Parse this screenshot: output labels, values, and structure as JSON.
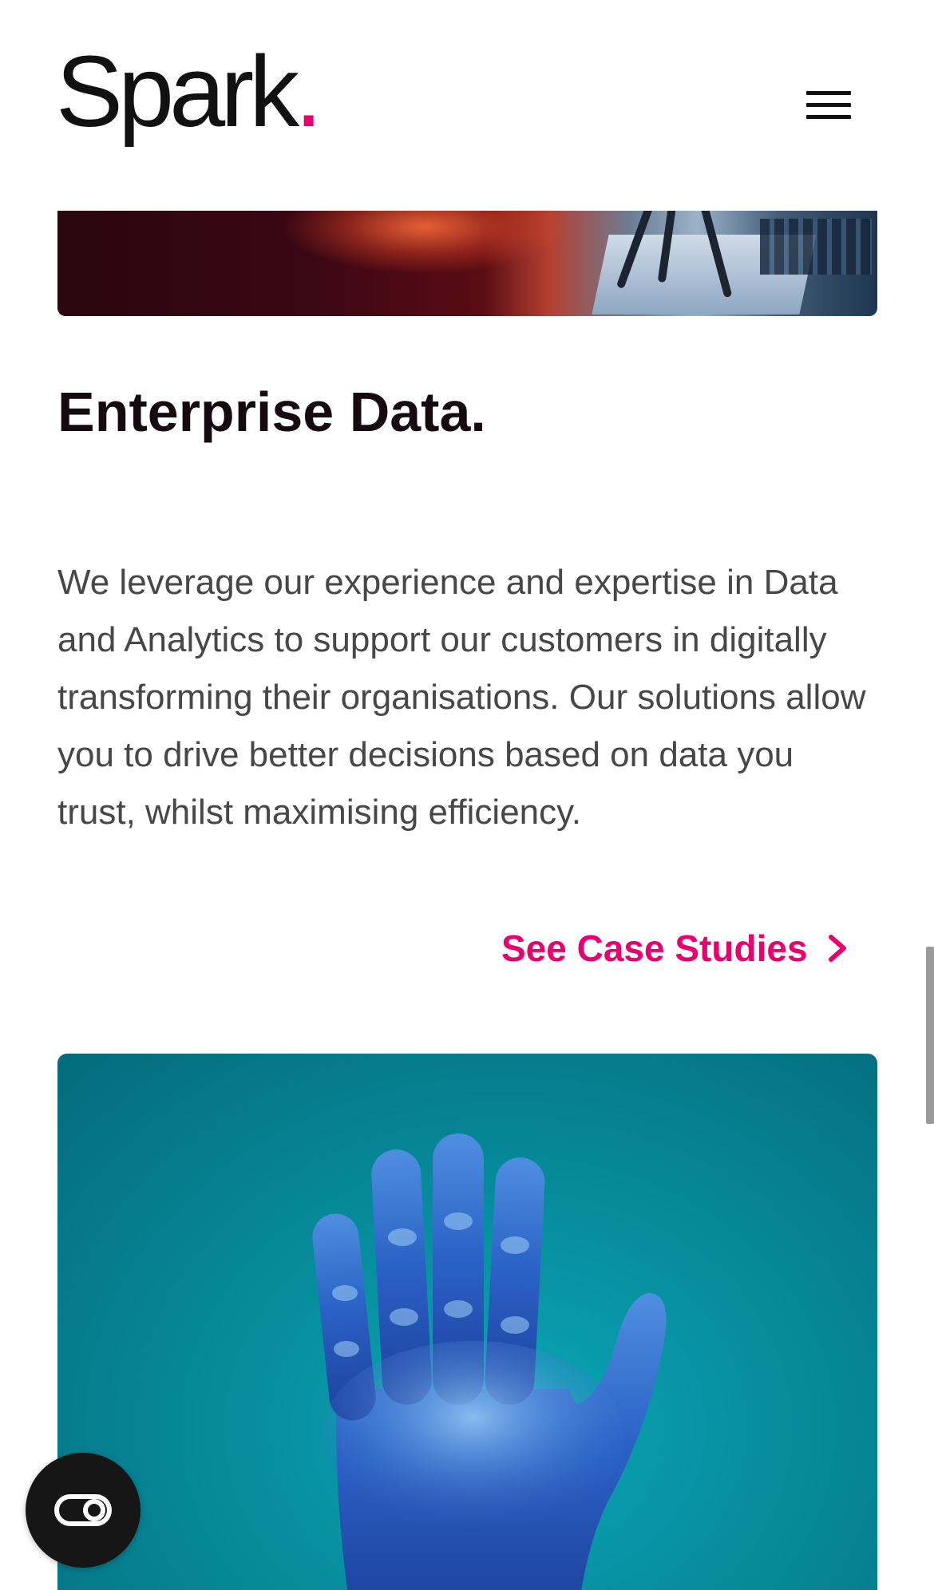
{
  "header": {
    "logo_text": "Spark",
    "logo_dot": ".",
    "menu_icon": "hamburger-menu-icon"
  },
  "section": {
    "title": "Enterprise Data.",
    "body": "We leverage our experience and expertise in Data and Analytics to support our customers in digitally transforming their organisations. Our solutions allow you to drive better decisions based on data you trust, whilst maximising efficiency.",
    "link_label": "See Case Studies",
    "link_icon": "chevron-right-icon"
  },
  "images": {
    "top": "abstract-tech-hardware-image",
    "bottom": "robotic-hand-image"
  },
  "floating_button": {
    "icon": "accessibility-toggle-icon"
  },
  "colors": {
    "brand_accent": "#e8006f",
    "heading": "#140a0f",
    "body_text": "#474747",
    "background": "#ffffff"
  }
}
